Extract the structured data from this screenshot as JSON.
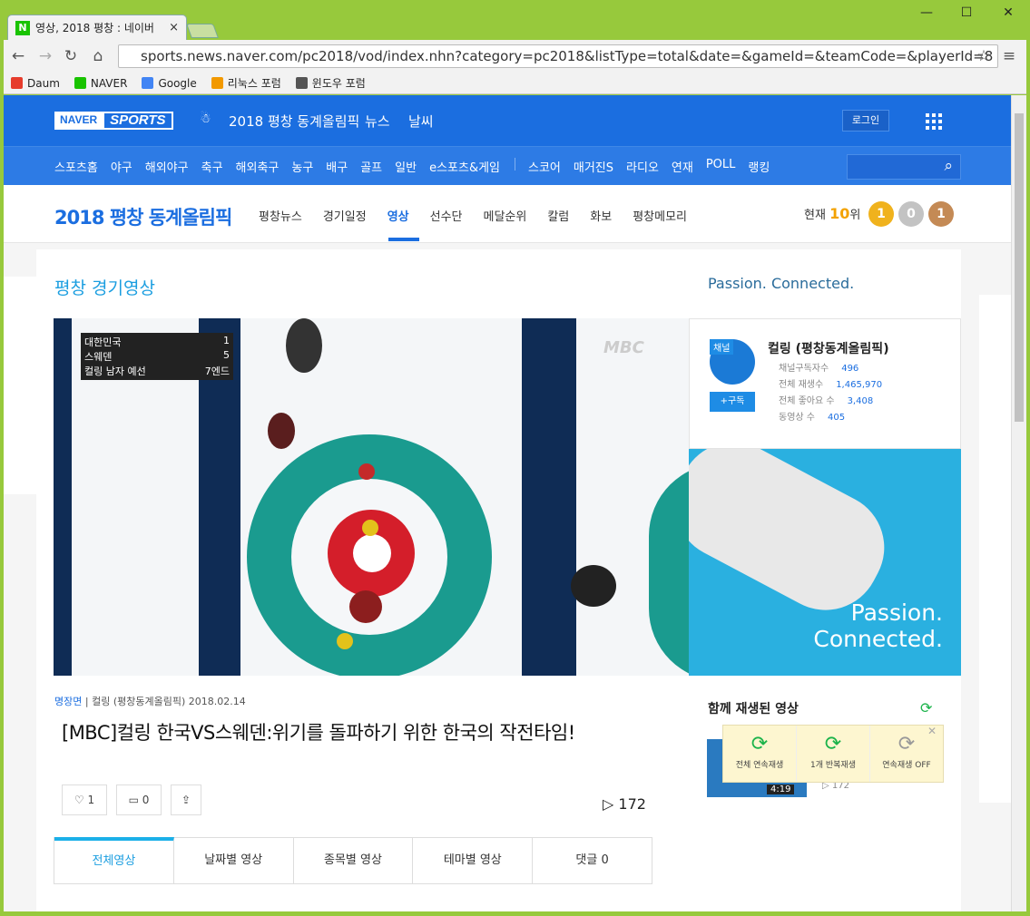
{
  "browser": {
    "tab_title": "영상, 2018 평창 : 네이버",
    "tab_close": "×",
    "url": "sports.news.naver.com/pc2018/vod/index.nhn?category=pc2018&listType=total&date=&gameId=&teamCode=&playerId=8",
    "bookmarks": [
      {
        "label": "Daum",
        "icon": "daum-icon",
        "color": "#e63c2c"
      },
      {
        "label": "NAVER",
        "icon": "naver-icon",
        "color": "#19c300"
      },
      {
        "label": "Google",
        "icon": "google-icon",
        "color": "#4285f4"
      },
      {
        "label": "리눅스 포럼",
        "icon": "forum-icon",
        "color": "#f29900"
      },
      {
        "label": "윈도우 포럼",
        "icon": "windows-icon",
        "color": "#555555"
      }
    ]
  },
  "header": {
    "logo_naver": "NAVER",
    "logo_sports": "SPORTS",
    "olympic_label": "2018 평창 동계올림픽",
    "news": "뉴스",
    "weather": "날씨",
    "login": "로그인",
    "nav": [
      "스포츠홈",
      "야구",
      "해외야구",
      "축구",
      "해외축구",
      "농구",
      "배구",
      "골프",
      "일반",
      "e스포츠&게임"
    ],
    "nav2": [
      "스코어",
      "매거진S",
      "라디오",
      "연재",
      "POLL",
      "랭킹"
    ]
  },
  "subheader": {
    "title": "2018 평창 동계올림픽",
    "nav": [
      "평창뉴스",
      "경기일정",
      "영상",
      "선수단",
      "메달순위",
      "칼럼",
      "화보",
      "평창메모리"
    ],
    "active": "영상",
    "rank_prefix": "현재",
    "rank_value": "10",
    "rank_suffix": "위",
    "medals": {
      "gold": "1",
      "silver": "0",
      "bronze": "1"
    }
  },
  "main": {
    "section_title": "평창 경기영상",
    "passion": "Passion. Connected.",
    "score": {
      "team1": "대한민국",
      "score1": "1",
      "team2": "스웨덴",
      "score2": "5",
      "event": "컬링 남자 예선",
      "end": "7엔드",
      "broadcaster": "MBC"
    },
    "channel": {
      "badge": "채널",
      "name": "컬링 (평창동계올림픽)",
      "subscribe": "+구독",
      "stats": [
        {
          "label": "채널구독자수",
          "value": "496"
        },
        {
          "label": "전체 재생수",
          "value": "1,465,970"
        },
        {
          "label": "전체 좋아요 수",
          "value": "3,408"
        },
        {
          "label": "동영상 수",
          "value": "405"
        }
      ]
    },
    "ad": {
      "line1": "Passion.",
      "line2": "Connected."
    },
    "meta": {
      "channel": "명장면",
      "category": "컬링 (평창동계올림픽)",
      "date": "2018.02.14"
    },
    "video_title": "[MBC]컬링 한국VS스웨덴:위기를 돌파하기 위한 한국의 작전타임!",
    "likes": "1",
    "comments": "0",
    "views": "172",
    "tabs": [
      "전체영상",
      "날짜별 영상",
      "종목별 영상",
      "테마별 영상",
      "댓글 0"
    ],
    "related_title": "함께 재생된 영상",
    "popup": [
      "전체 연속재생",
      "1개 반복재생",
      "연속재생 OFF"
    ],
    "related_duration": "4:19",
    "related_views": "172"
  }
}
